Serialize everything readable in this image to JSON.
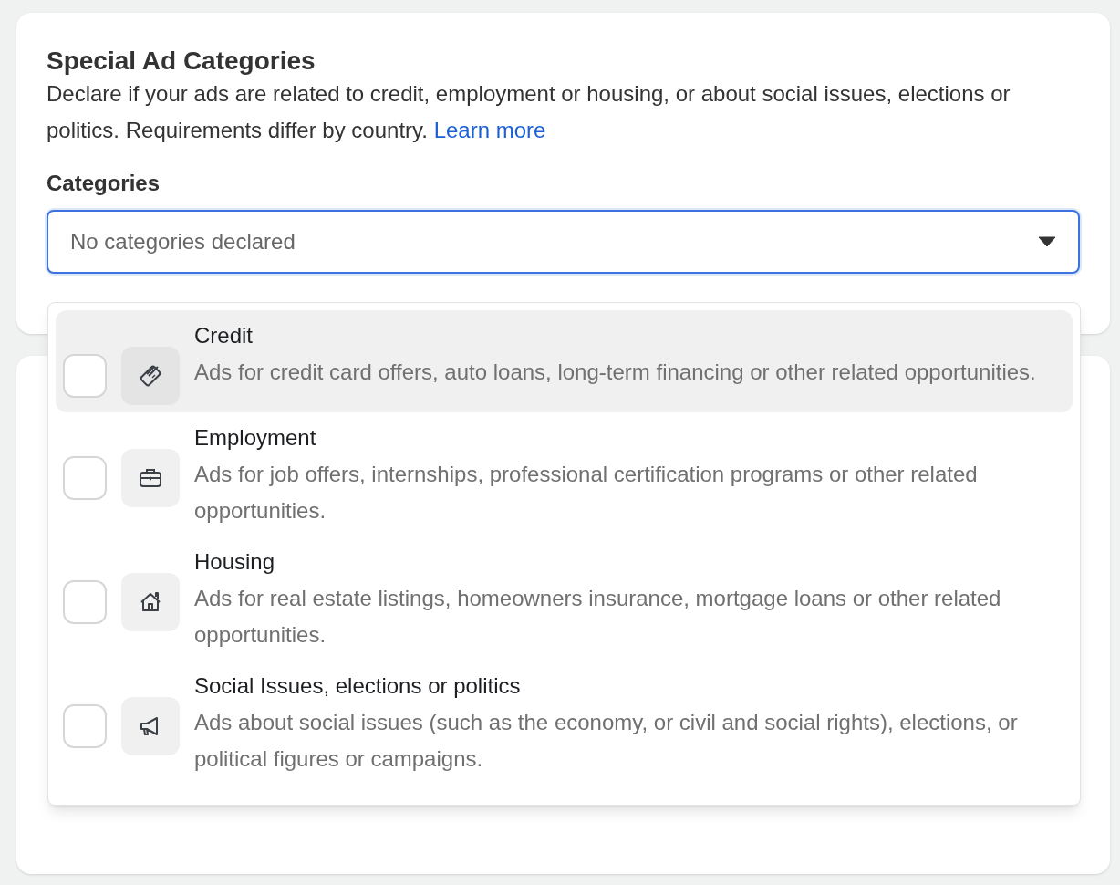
{
  "section": {
    "title": "Special Ad Categories",
    "description": "Declare if your ads are related to credit, employment or housing, or about social issues, elections or politics. Requirements differ by country.",
    "link": "Learn more"
  },
  "categories_field": {
    "label": "Categories",
    "placeholder": "No categories declared",
    "expanded": true
  },
  "options": [
    {
      "kind": "credit",
      "title": "Credit",
      "description": "Ads for credit card offers, auto loans, long-term financing or other related opportunities.",
      "checked": false,
      "highlighted": true
    },
    {
      "kind": "employment",
      "title": "Employment",
      "description": "Ads for job offers, internships, professional certification programs or other related opportunities.",
      "checked": false,
      "highlighted": false
    },
    {
      "kind": "housing",
      "title": "Housing",
      "description": "Ads for real estate listings, homeowners insurance, mortgage loans or other related opportunities.",
      "checked": false,
      "highlighted": false
    },
    {
      "kind": "politics",
      "title": "Social Issues, elections or politics",
      "description": "Ads about social issues (such as the economy, or civil and social rights), elections, or political figures or campaigns.",
      "checked": false,
      "highlighted": false
    }
  ]
}
